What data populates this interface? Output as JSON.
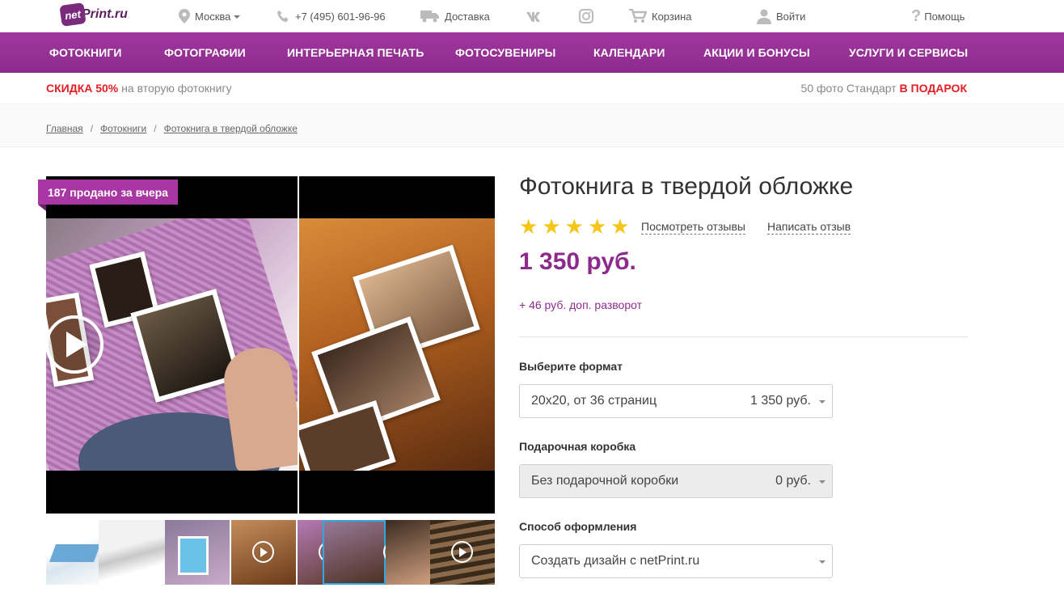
{
  "topbar": {
    "logo": "netPrint.ru",
    "logo_badge": "net",
    "logo_suffix": "Print.ru",
    "city": "Москва",
    "phone": "+7 (495) 601-96-96",
    "delivery": "Доставка",
    "cart": "Корзина",
    "login": "Войти",
    "help": "Помощь"
  },
  "nav": {
    "items": [
      "ФОТОКНИГИ",
      "ФОТОГРАФИИ",
      "ИНТЕРЬЕРНАЯ ПЕЧАТЬ",
      "ФОТОСУВЕНИРЫ",
      "КАЛЕНДАРИ",
      "АКЦИИ И БОНУСЫ",
      "УСЛУГИ И СЕРВИСЫ"
    ]
  },
  "promo": {
    "left_highlight": "СКИДКА 50%",
    "left_text": " на вторую фотокнигу",
    "right_text": "50 фото Стандарт ",
    "right_highlight": "В ПОДАРОК"
  },
  "breadcrumb": {
    "items": [
      "Главная",
      "Фотокниги",
      "Фотокнига в твердой обложке"
    ],
    "separator": "/"
  },
  "gallery": {
    "sold_badge": "187 продано за вчера",
    "thumb_count": 7,
    "active_thumb": 4
  },
  "product": {
    "title": "Фотокнига в твердой обложке",
    "rating_stars": 5,
    "reviews_link": "Посмотреть отзывы",
    "write_review_link": "Написать отзыв",
    "price": "1 350 руб.",
    "extra_spread": "+ 46 руб. доп. разворот"
  },
  "options": {
    "format": {
      "label": "Выберите формат",
      "value": "20х20, от 36 страниц",
      "price": "1 350 руб."
    },
    "gift_box": {
      "label": "Подарочная коробка",
      "value": "Без подарочной коробки",
      "price": "0 руб."
    },
    "design": {
      "label": "Способ оформления",
      "value": "Создать дизайн с netPrint.ru"
    }
  },
  "colors": {
    "brand_purple": "#8d2b8d",
    "promo_red": "#e31e24",
    "star_yellow": "#f5c518",
    "thumb_active": "#2fa7e0"
  }
}
